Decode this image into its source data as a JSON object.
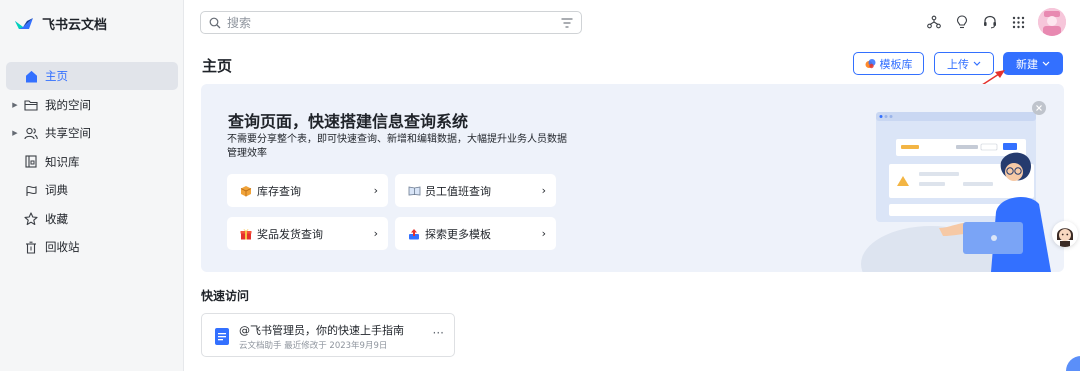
{
  "app": {
    "name": "飞书云文档"
  },
  "sidebar": {
    "items": [
      {
        "label": "主页",
        "icon": "home-icon",
        "active": true,
        "expandable": false
      },
      {
        "label": "我的空间",
        "icon": "folder-icon",
        "active": false,
        "expandable": true
      },
      {
        "label": "共享空间",
        "icon": "people-icon",
        "active": false,
        "expandable": true
      },
      {
        "label": "知识库",
        "icon": "book-icon",
        "active": false,
        "expandable": false
      },
      {
        "label": "词典",
        "icon": "dictionary-icon",
        "active": false,
        "expandable": false
      },
      {
        "label": "收藏",
        "icon": "star-icon",
        "active": false,
        "expandable": false
      },
      {
        "label": "回收站",
        "icon": "trash-icon",
        "active": false,
        "expandable": false
      }
    ]
  },
  "search": {
    "placeholder": "搜索"
  },
  "header": {
    "title": "主页",
    "template_button": "模板库",
    "upload_button": "上传",
    "new_button": "新建"
  },
  "banner": {
    "title": "查询页面，快速搭建信息查询系统",
    "description": "不需要分享整个表，即可快速查询、新增和编辑数据，大幅提升业务人员数据管理效率",
    "cards": [
      {
        "label": "库存查询",
        "icon": "box-icon"
      },
      {
        "label": "员工值班查询",
        "icon": "book-open-icon"
      },
      {
        "label": "奖品发货查询",
        "icon": "gift-icon"
      },
      {
        "label": "探索更多模板",
        "icon": "upload-tray-icon"
      }
    ]
  },
  "quick_access": {
    "title": "快速访问",
    "doc": {
      "title": "@飞书管理员，你的快速上手指南",
      "meta": "云文档助手 最近修改于 2023年9月9日",
      "more": "···"
    }
  },
  "colors": {
    "accent": "#3370ff",
    "banner_bg": "#eef2fa",
    "sidebar_bg": "#f5f6f7",
    "arrow": "#e5322d"
  }
}
